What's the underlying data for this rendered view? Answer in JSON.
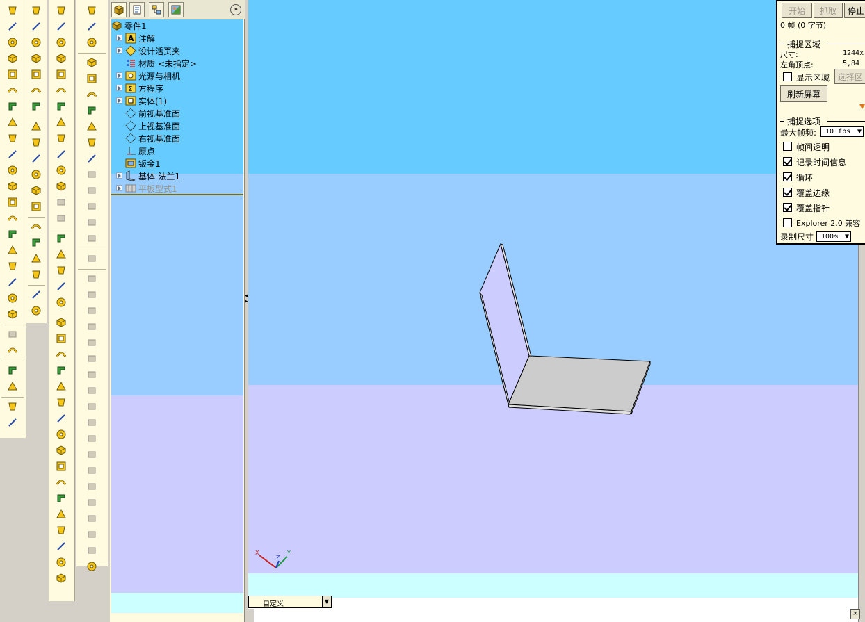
{
  "feature_tree": {
    "tabs": [
      "feature-manager-icon",
      "property-manager-icon",
      "configuration-manager-icon",
      "display-manager-icon"
    ],
    "items": [
      {
        "label": "零件1",
        "icon": "part-icon"
      },
      {
        "label": "注解",
        "icon": "annotation-icon"
      },
      {
        "label": "设计活页夹",
        "icon": "design-binder-icon"
      },
      {
        "label": "材质 <未指定>",
        "icon": "material-icon"
      },
      {
        "label": "光源与相机",
        "icon": "lights-camera-icon"
      },
      {
        "label": "方程序",
        "icon": "equations-icon"
      },
      {
        "label": "实体(1)",
        "icon": "solid-bodies-icon"
      },
      {
        "label": "前视基准面",
        "icon": "plane-icon"
      },
      {
        "label": "上视基准面",
        "icon": "plane-icon"
      },
      {
        "label": "右视基准面",
        "icon": "plane-icon"
      },
      {
        "label": "原点",
        "icon": "origin-icon"
      },
      {
        "label": "钣金1",
        "icon": "sheet-metal-icon"
      },
      {
        "label": "基体-法兰1",
        "icon": "base-flange-icon"
      },
      {
        "label": "平板型式1",
        "icon": "flat-pattern-icon"
      }
    ]
  },
  "viewport": {
    "view_dropdown": "自定义",
    "triad": {
      "x": "X",
      "y": "Y",
      "z": "Z"
    }
  },
  "capture": {
    "start_label": "开始",
    "grab_label": "抓取",
    "stop_label": "停止",
    "status": "0 帧 (0 字节)",
    "region_header": "捕捉区域",
    "size_label": "尺寸:",
    "size_value": "1244x",
    "corner_label": "左角顶点:",
    "corner_value": "5,84",
    "show_region_label": "显示区域",
    "show_region_checked": false,
    "select_region_label": "选择区",
    "refresh_label": "刷新屏幕",
    "options_header": "捕捉选项",
    "max_fps_label": "最大帧频:",
    "max_fps_value": "10 fps",
    "options": [
      {
        "label": "帧间透明",
        "checked": false
      },
      {
        "label": "记录时间信息",
        "checked": true
      },
      {
        "label": "循环",
        "checked": true
      },
      {
        "label": "覆盖边缘",
        "checked": true
      },
      {
        "label": "覆盖指针",
        "checked": true
      },
      {
        "label": "Explorer 2.0 兼容",
        "checked": false
      }
    ],
    "rec_size_label": "录制尺寸",
    "rec_size_value": "100%"
  },
  "colors": {
    "toolbar_bg": "#fffbe0",
    "viewport_sky": "#66ccff",
    "viewport_mid": "#99ccff",
    "viewport_low": "#ccccff",
    "viewport_floor": "#ccffff",
    "tree_highlight": "#66ccff"
  }
}
